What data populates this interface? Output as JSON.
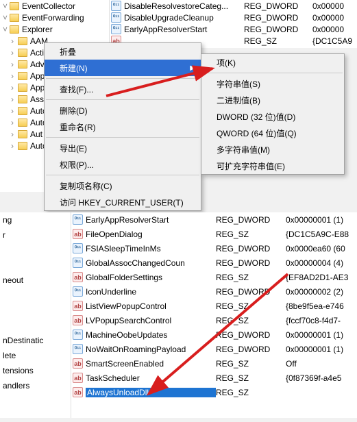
{
  "tree_top": [
    "EventCollector",
    "EventForwarding",
    "Explorer",
    "AAM",
    "Activ",
    "Adva",
    "App",
    "App",
    "Assoc",
    "Autc",
    "Auto",
    "Aut",
    "Auto"
  ],
  "values_top": [
    {
      "icon": "dword",
      "name": "DisableResolvestoreCateg...",
      "type": "REG_DWORD",
      "data": "0x00000"
    },
    {
      "icon": "dword",
      "name": "DisableUpgradeCleanup",
      "type": "REG_DWORD",
      "data": "0x00000"
    },
    {
      "icon": "dword",
      "name": "EarlyAppResolverStart",
      "type": "REG_DWORD",
      "data": "0x00000"
    },
    {
      "icon": "sz",
      "name": "",
      "type": "REG_SZ",
      "data": "{DC1C5A9"
    }
  ],
  "ctx1": [
    {
      "label": "折叠",
      "type": "item"
    },
    {
      "label": "新建(N)",
      "type": "hl",
      "sub": true
    },
    {
      "type": "sep"
    },
    {
      "label": "查找(F)...",
      "type": "item"
    },
    {
      "type": "sep"
    },
    {
      "label": "删除(D)",
      "type": "item"
    },
    {
      "label": "重命名(R)",
      "type": "item"
    },
    {
      "type": "sep"
    },
    {
      "label": "导出(E)",
      "type": "item"
    },
    {
      "label": "权限(P)...",
      "type": "item"
    },
    {
      "type": "sep"
    },
    {
      "label": "复制项名称(C)",
      "type": "item"
    },
    {
      "label": "访问 HKEY_CURRENT_USER(T)",
      "type": "item"
    }
  ],
  "ctx2": [
    {
      "label": "项(K)"
    },
    {
      "type": "sep"
    },
    {
      "label": "字符串值(S)"
    },
    {
      "label": "二进制值(B)"
    },
    {
      "label": "DWORD (32 位)值(D)"
    },
    {
      "label": "QWORD (64 位)值(Q)"
    },
    {
      "label": "多字符串值(M)"
    },
    {
      "label": "可扩充字符串值(E)"
    }
  ],
  "tree_bottom": [
    "ng",
    "r",
    "",
    "",
    "neout",
    "",
    "",
    "",
    "nDestinatic",
    "lete",
    "tensions",
    "andlers",
    ""
  ],
  "values_bottom": [
    {
      "icon": "dword",
      "name": "EarlyAppResolverStart",
      "type": "REG_DWORD",
      "data": "0x00000001 (1)"
    },
    {
      "icon": "sz",
      "name": "FileOpenDialog",
      "type": "REG_SZ",
      "data": "{DC1C5A9C-E88"
    },
    {
      "icon": "dword",
      "name": "FSIASleepTimeInMs",
      "type": "REG_DWORD",
      "data": "0x0000ea60 (60"
    },
    {
      "icon": "dword",
      "name": "GlobalAssocChangedCoun",
      "type": "REG_DWORD",
      "data": "0x00000004 (4)"
    },
    {
      "icon": "sz",
      "name": "GlobalFolderSettings",
      "type": "REG_SZ",
      "data": "{EF8AD2D1-AE3"
    },
    {
      "icon": "dword",
      "name": "IconUnderline",
      "type": "REG_DWORD",
      "data": "0x00000002 (2)"
    },
    {
      "icon": "sz",
      "name": "ListViewPopupControl",
      "type": "REG_SZ",
      "data": "{8be9f5ea-e746"
    },
    {
      "icon": "sz",
      "name": "LVPopupSearchControl",
      "type": "REG_SZ",
      "data": "{fccf70c8-f4d7-"
    },
    {
      "icon": "dword",
      "name": "MachineOobeUpdates",
      "type": "REG_DWORD",
      "data": "0x00000001 (1)"
    },
    {
      "icon": "dword",
      "name": "NoWaitOnRoamingPayload",
      "type": "REG_DWORD",
      "data": "0x00000001 (1)"
    },
    {
      "icon": "sz",
      "name": "SmartScreenEnabled",
      "type": "REG_SZ",
      "data": "Off"
    },
    {
      "icon": "sz",
      "name": "TaskScheduler",
      "type": "REG_SZ",
      "data": "{0f87369f-a4e5"
    },
    {
      "icon": "sz",
      "name": "AlwaysUnloadDll",
      "type": "REG_SZ",
      "data": "",
      "sel": true
    }
  ]
}
